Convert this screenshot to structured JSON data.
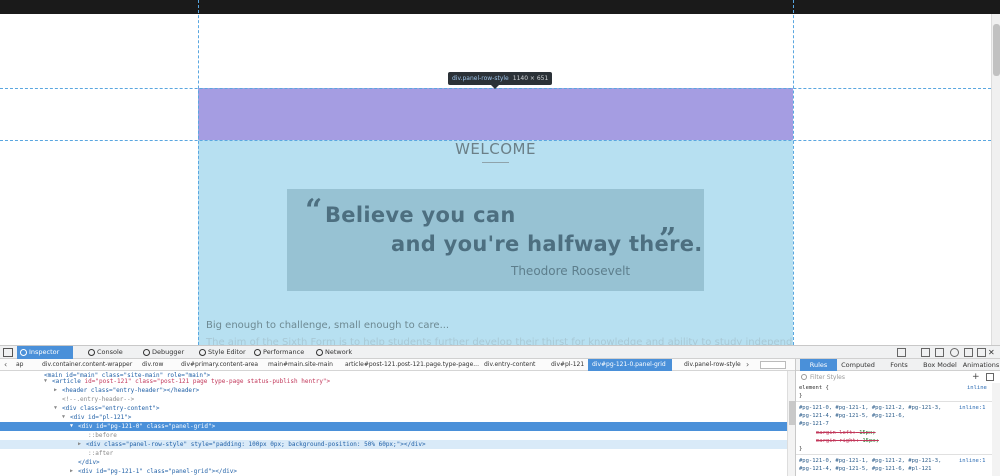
{
  "page": {
    "tooltip": {
      "selector": "div.panel-row-style",
      "dimensions": "1140 × 651"
    },
    "content": {
      "welcome": "WELCOME",
      "quote_open": "“",
      "quote_line1": "Believe you can",
      "quote_line2": "and you're halfway there.",
      "quote_close": "”",
      "quote_author": "Theodore Roosevelt",
      "tagline": "Big enough to challenge, small enough to care...",
      "paragraph": "The aim of the Sixth Form is to help students further develop their thirst for knowledge and ability to study independently"
    }
  },
  "devtools": {
    "tabs": [
      {
        "label": "Inspector",
        "icon": "inspector-icon"
      },
      {
        "label": "Console",
        "icon": "console-icon"
      },
      {
        "label": "Debugger",
        "icon": "debugger-icon"
      },
      {
        "label": "Style Editor",
        "icon": "style-editor-icon"
      },
      {
        "label": "Performance",
        "icon": "performance-icon"
      },
      {
        "label": "Network",
        "icon": "network-icon"
      }
    ],
    "active_tab": "Inspector",
    "breadcrumbs": [
      "ap",
      "div.container.content-wrapper",
      "div.row",
      "div#primary.content-area",
      "main#main.site-main",
      "article#post-121.post-121.page.type-page...",
      "div.entry-content",
      "div#pl-121",
      "div#pg-121-0.panel-grid",
      "div.panel-row-style"
    ],
    "selected_breadcrumb": "div#pg-121-0.panel-grid",
    "markup": {
      "line0": "<main id=\"main\" class=\"site-main\" role=\"main\">",
      "line1_tag": "<article",
      "line1_attrs": " id=\"post-121\" class=\"post-121 page type-page status-publish hentry\">",
      "line2": "<header class=\"entry-header\"></header>",
      "line3": "<!--.entry-header-->",
      "line4": "<div class=\"entry-content\">",
      "line5": "<div id=\"pl-121\">",
      "line6": "<div id=\"pg-121-0\" class=\"panel-grid\">",
      "line7": "::before",
      "line8": "<div class=\"panel-row-style\" style=\"padding: 100px 0px; background-position: 50% 60px;\"></div>",
      "line9": "::after",
      "line10": "</div>",
      "line11": "<div id=\"pg-121-1\" class=\"panel-grid\"></div>",
      "line12": "<div id=\"pg-121-2\" class=\"panel-grid\"></div>"
    },
    "sidebar": {
      "tabs": [
        "Rules",
        "Computed",
        "Fonts",
        "Box Model",
        "Animations"
      ],
      "active_tab": "Rules",
      "filter_placeholder": "Filter Styles",
      "rules": {
        "element": "element {",
        "element_source": "inline",
        "close": "}",
        "sel1": "#pg-121-0, #pg-121-1, #pg-121-2, #pg-121-3,",
        "sel1_source": "inline:1",
        "sel2": "#pg-121-4, #pg-121-5, #pg-121-6,",
        "sel3": "#pg-121-7",
        "prop1_name": "margin-left:",
        "prop1_value": "15px;",
        "prop2_name": "margin-right:",
        "prop2_value": "15px;",
        "sel4": "#pg-121-0, #pg-121-1, #pg-121-2, #pg-121-3,",
        "sel4_source": "inline:1",
        "sel5": "#pg-121-4, #pg-121-5, #pg-121-6, #pl-121"
      }
    }
  },
  "colors": {
    "padding_highlight": "#a59de2",
    "content_highlight": "#b7e0f1",
    "selection": "#4a90d9"
  }
}
